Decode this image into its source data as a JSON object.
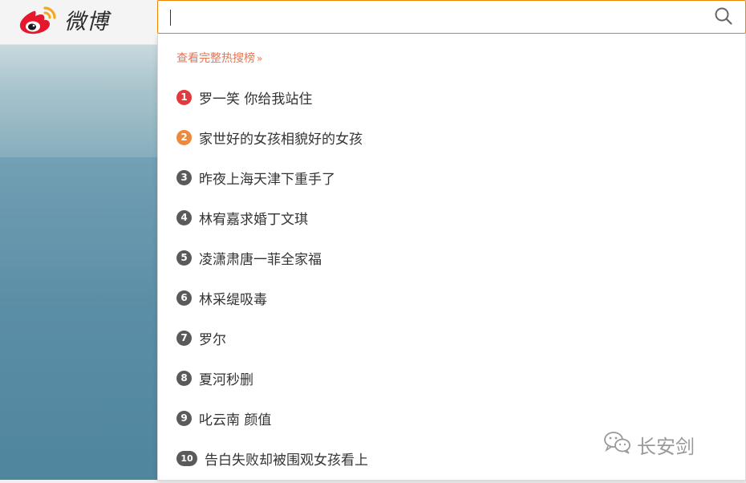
{
  "brand": {
    "name": "微博",
    "logo_icon": "weibo-logo-icon",
    "logo_color": "#e6162d",
    "eye_color": "#f5a623"
  },
  "search": {
    "value": "",
    "placeholder": "",
    "button_icon": "search-icon",
    "border_color": "#f08300"
  },
  "dropdown": {
    "full_link_label": "查看完整热搜榜",
    "full_link_arrow": "»",
    "link_color": "#eb7350",
    "items": [
      {
        "rank": "1",
        "text": "罗一笑 你给我站住",
        "color": "#e4393c"
      },
      {
        "rank": "2",
        "text": "家世好的女孩相貌好的女孩",
        "color": "#f0883a"
      },
      {
        "rank": "3",
        "text": "昨夜上海天津下重手了",
        "color": "#5a5a5a"
      },
      {
        "rank": "4",
        "text": "林宥嘉求婚丁文琪",
        "color": "#5a5a5a"
      },
      {
        "rank": "5",
        "text": "凌潇肃唐一菲全家福",
        "color": "#5a5a5a"
      },
      {
        "rank": "6",
        "text": "林采缇吸毒",
        "color": "#5a5a5a"
      },
      {
        "rank": "7",
        "text": "罗尔",
        "color": "#5a5a5a"
      },
      {
        "rank": "8",
        "text": "夏河秒删",
        "color": "#5a5a5a"
      },
      {
        "rank": "9",
        "text": "叱云南 颜值",
        "color": "#5a5a5a"
      },
      {
        "rank": "10",
        "text": "告白失败却被围观女孩看上",
        "color": "#5a5a5a"
      }
    ]
  },
  "watermark": {
    "icon": "wechat-icon",
    "text": "长安剑"
  }
}
